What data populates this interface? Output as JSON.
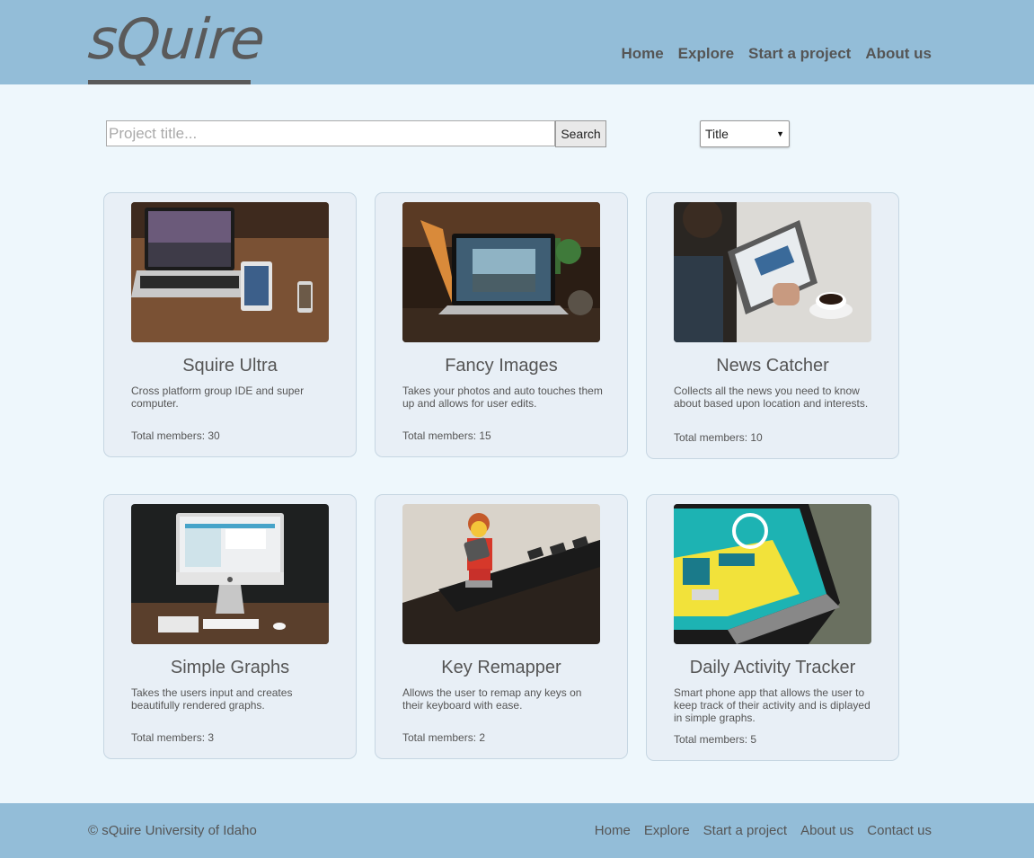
{
  "header": {
    "logo": "sQuire",
    "nav": [
      "Home",
      "Explore",
      "Start a project",
      "About us"
    ]
  },
  "search": {
    "placeholder": "Project title...",
    "button_label": "Search",
    "sort_value": "Title"
  },
  "projects": [
    {
      "title": "Squire Ultra",
      "description": "Cross platform group IDE and super computer.",
      "members": "Total members: 30",
      "image": "laptop-tablet-phone-photo"
    },
    {
      "title": "Fancy Images",
      "description": "Takes your photos and auto touches them up and allows for user edits.",
      "members": "Total members: 15",
      "image": "laptop-photo-editing-photo"
    },
    {
      "title": "News Catcher",
      "description": "Collects all the news you need to know about based upon location and interests.",
      "members": "Total members: 10",
      "image": "tablet-news-coffee-photo"
    },
    {
      "title": "Simple Graphs",
      "description": "Takes the users input and creates beautifully rendered graphs.",
      "members": "Total members: 3",
      "image": "desktop-computer-photo"
    },
    {
      "title": "Key Remapper",
      "description": "Allows the user to remap any keys on their keyboard with ease.",
      "members": "Total members: 2",
      "image": "lego-keyboard-photo"
    },
    {
      "title": "Daily Activity Tracker",
      "description": "Smart phone app that allows the user to keep track of their activity and is diplayed in simple graphs.",
      "members": "Total members: 5",
      "image": "smartphone-app-photo"
    }
  ],
  "footer": {
    "copyright": "© sQuire University of Idaho",
    "nav": [
      "Home",
      "Explore",
      "Start a project",
      "About us",
      "Contact us"
    ]
  },
  "colors": {
    "header_bg": "#93bdd8",
    "page_bg": "#eef7fc",
    "card_bg": "#e8eff6",
    "text": "#555555"
  }
}
